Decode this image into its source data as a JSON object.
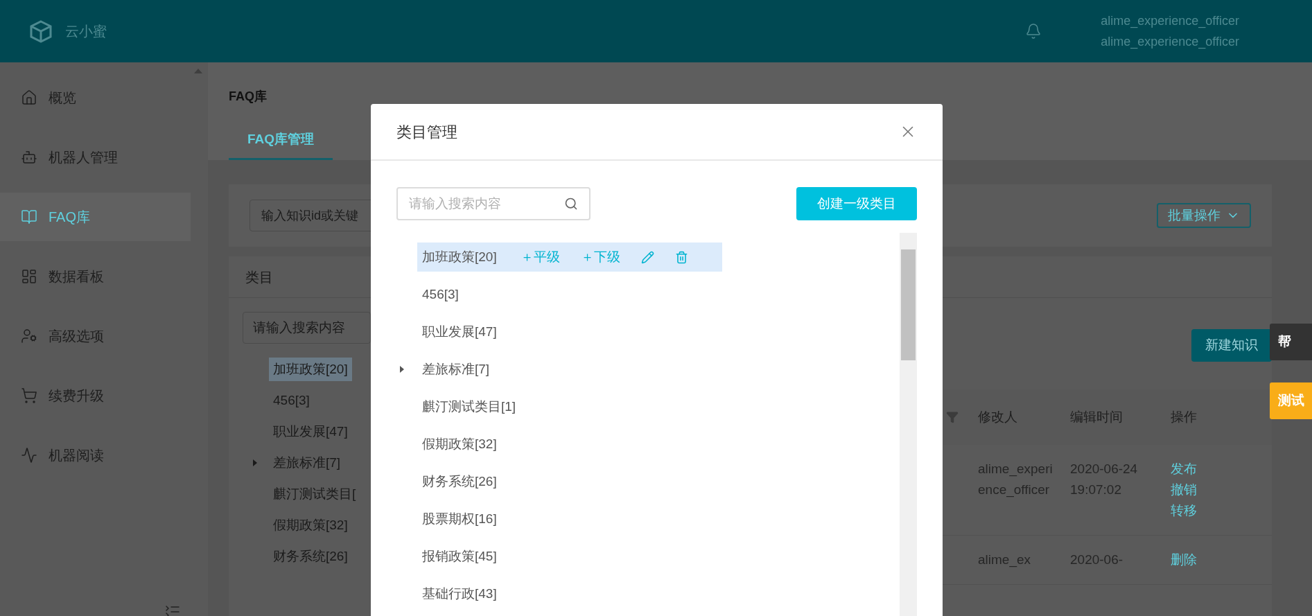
{
  "header": {
    "brand": "云小蜜",
    "user_lines": [
      "alime_experience_officer",
      "alime_experience_officer"
    ]
  },
  "sidebar": {
    "items": [
      {
        "label": "概览",
        "selected": false
      },
      {
        "label": "机器人管理",
        "selected": false
      },
      {
        "label": "FAQ库",
        "selected": true
      },
      {
        "label": "数据看板",
        "selected": false
      },
      {
        "label": "高级选项",
        "selected": false
      },
      {
        "label": "续费升级",
        "selected": false
      },
      {
        "label": "机器阅读",
        "selected": false
      }
    ]
  },
  "page": {
    "title": "FAQ库",
    "tabs": [
      {
        "label": "FAQ库管理",
        "selected": true
      }
    ],
    "search": {
      "placeholder": "输入知识id或关键"
    },
    "batch_button": "批量操作",
    "category_panel": {
      "title": "类目",
      "search_placeholder": "请输入搜索内容",
      "tree": [
        {
          "label": "加班政策[20]",
          "selected": true,
          "expandable": false
        },
        {
          "label": "456[3]",
          "selected": false,
          "expandable": false
        },
        {
          "label": "职业发展[47]",
          "selected": false,
          "expandable": false
        },
        {
          "label": "差旅标准[7]",
          "selected": false,
          "expandable": true
        },
        {
          "label": "麒汀测试类目[",
          "selected": false,
          "expandable": false
        },
        {
          "label": "假期政策[32]",
          "selected": false,
          "expandable": false
        },
        {
          "label": "财务系统[26]",
          "selected": false,
          "expandable": false
        }
      ]
    },
    "new_button": "新建知识",
    "table": {
      "columns": [
        "修改人",
        "编辑时间",
        "操作"
      ],
      "rows": [
        {
          "editor": "alime_experience_officer",
          "time": "2020-06-24 19:07:02",
          "actions": [
            "发布",
            "撤销",
            "转移"
          ]
        },
        {
          "editor": "alime_ex",
          "time": "2020-06-",
          "actions": [
            "删除"
          ]
        }
      ]
    }
  },
  "floating_tabs": [
    {
      "label": "帮",
      "kind": "help"
    },
    {
      "label": "测试",
      "kind": "test"
    }
  ],
  "modal": {
    "title": "类目管理",
    "search_placeholder": "请输入搜索内容",
    "create_button": "创建一级类目",
    "row_actions": [
      "＋平级",
      "＋下级"
    ],
    "tree": [
      {
        "label": "加班政策[20]",
        "selected": true,
        "expandable": false
      },
      {
        "label": "456[3]",
        "selected": false,
        "expandable": false
      },
      {
        "label": "职业发展[47]",
        "selected": false,
        "expandable": false
      },
      {
        "label": "差旅标准[7]",
        "selected": false,
        "expandable": true
      },
      {
        "label": "麒汀测试类目[1]",
        "selected": false,
        "expandable": false
      },
      {
        "label": "假期政策[32]",
        "selected": false,
        "expandable": false
      },
      {
        "label": "财务系统[26]",
        "selected": false,
        "expandable": false
      },
      {
        "label": "股票期权[16]",
        "selected": false,
        "expandable": false
      },
      {
        "label": "报销政策[45]",
        "selected": false,
        "expandable": false
      },
      {
        "label": "基础行政[43]",
        "selected": false,
        "expandable": false
      }
    ]
  }
}
